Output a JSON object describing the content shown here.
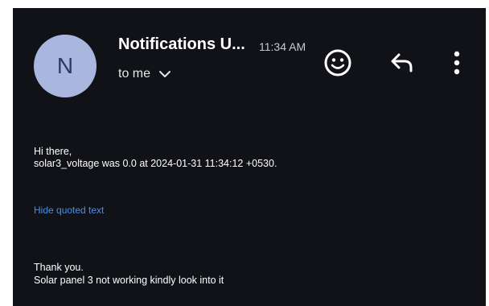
{
  "header": {
    "avatar_letter": "N",
    "sender": "Notifications U...",
    "time": "11:34 AM",
    "recipient": "to me"
  },
  "icons": {
    "emoji": "smiley-icon",
    "reply": "reply-arrow-icon",
    "more": "vertical-dots-icon",
    "expand": "chevron-down-icon"
  },
  "body": {
    "greeting": "Hi there,",
    "message": "solar3_voltage was 0.0 at 2024-01-31 11:34:12 +0530.",
    "hide_quoted": "Hide quoted text",
    "thanks": "Thank you.",
    "note": "Solar panel 3 not working kindly look into it"
  },
  "colors": {
    "background": "#101217",
    "avatar": "#a9b6dd",
    "link": "#4a8ee8"
  }
}
